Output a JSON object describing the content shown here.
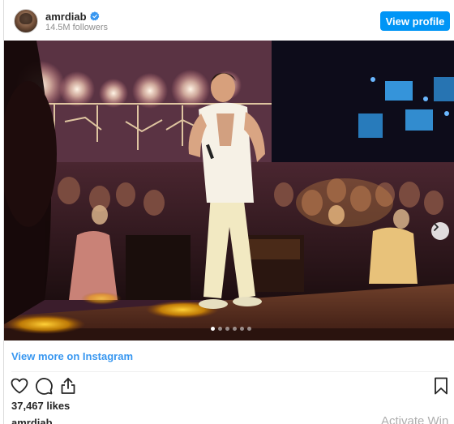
{
  "header": {
    "username": "amrdiab",
    "followers": "14.5M followers",
    "view_profile_label": "View profile"
  },
  "photo": {
    "icons": {
      "next": "chevron-right-icon"
    },
    "carousel_dot_count": 6,
    "carousel_active_index": 0
  },
  "footer": {
    "view_more_label": "View more on Instagram",
    "likes": "37,467 likes",
    "caption_user": "amrdiab",
    "icons": [
      "heart-icon",
      "comment-icon",
      "share-icon",
      "bookmark-icon"
    ]
  },
  "overlay": {
    "watermark": "Activate Win"
  },
  "colors": {
    "accent": "#0095f6",
    "link": "#3897f0",
    "verified": "#3897f0"
  }
}
